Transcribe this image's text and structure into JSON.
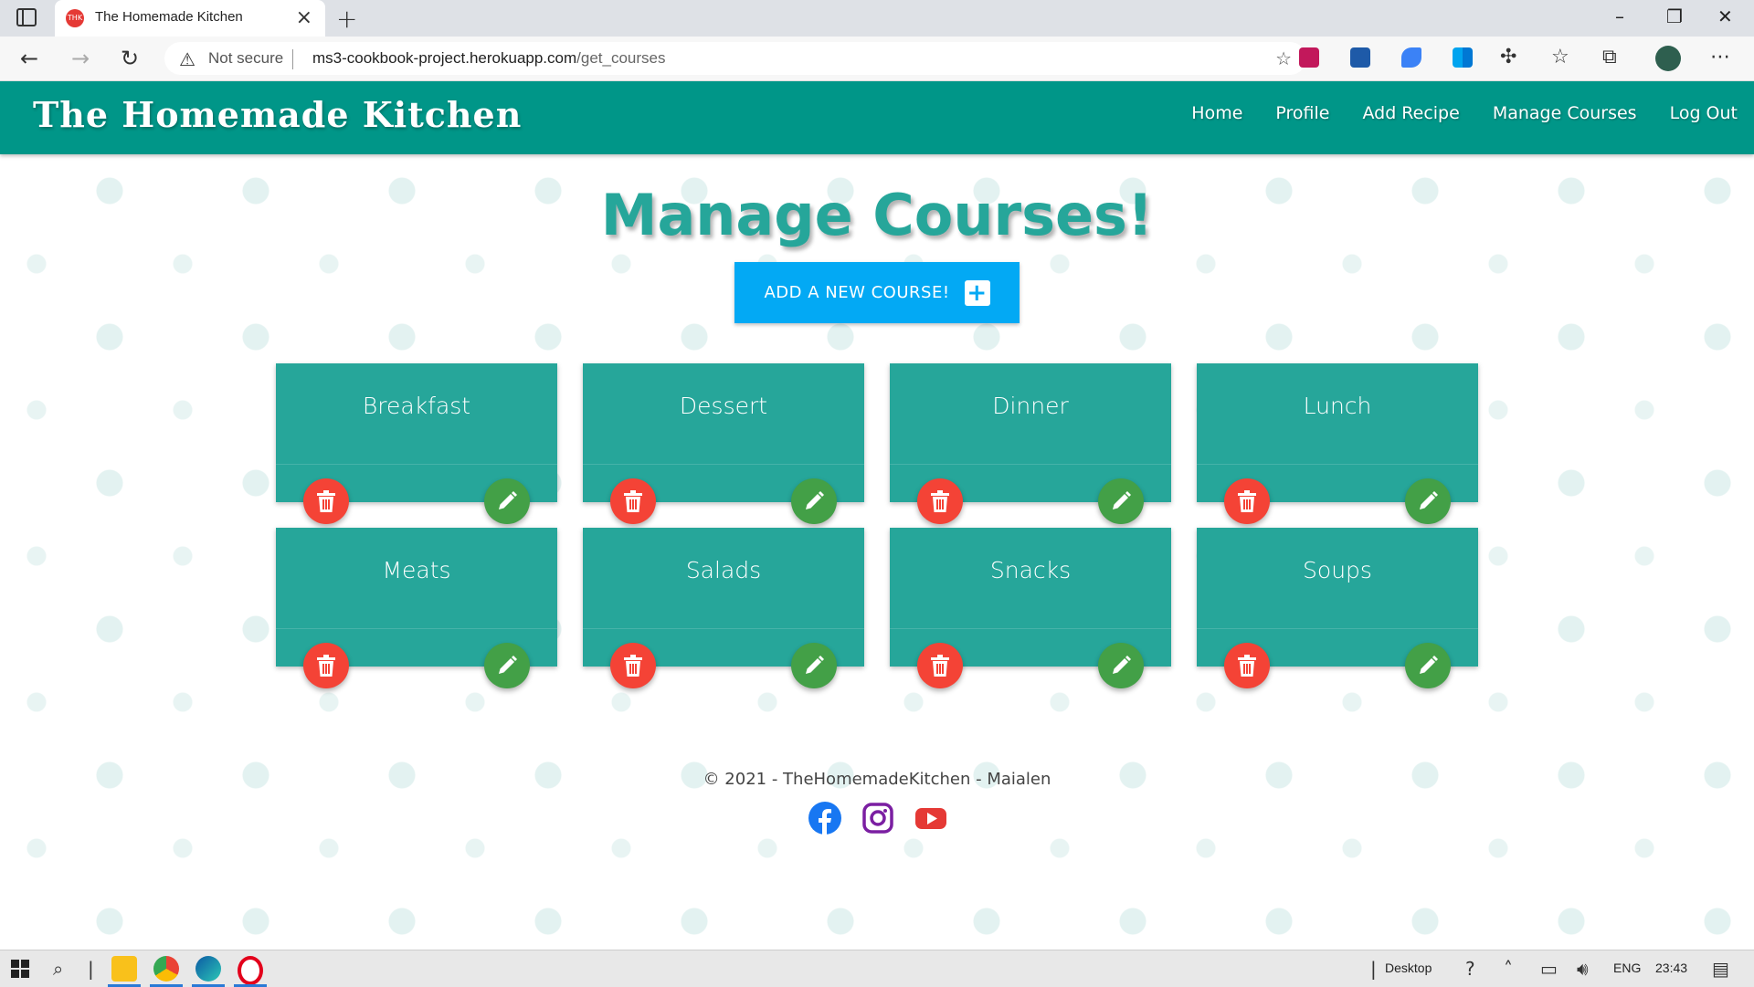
{
  "browser": {
    "tab_title": "The Homemade Kitchen",
    "tab_favicon_text": "THK",
    "security_label": "Not secure",
    "url_host": "ms3-cookbook-project.herokuapp.com",
    "url_path": "/get_courses"
  },
  "site": {
    "brand": "The Homemade Kitchen",
    "nav": [
      {
        "label": "Home"
      },
      {
        "label": "Profile"
      },
      {
        "label": "Add Recipe"
      },
      {
        "label": "Manage Courses"
      },
      {
        "label": "Log Out"
      }
    ]
  },
  "main": {
    "title": "Manage Courses!",
    "add_button_label": "ADD A NEW COURSE!",
    "courses": [
      {
        "name": "Breakfast"
      },
      {
        "name": "Dessert"
      },
      {
        "name": "Dinner"
      },
      {
        "name": "Lunch"
      },
      {
        "name": "Meats"
      },
      {
        "name": "Salads"
      },
      {
        "name": "Snacks"
      },
      {
        "name": "Soups"
      }
    ]
  },
  "footer": {
    "text": "© 2021 - TheHomemadeKitchen - Maialen",
    "socials": [
      "facebook-icon",
      "instagram-icon",
      "youtube-icon"
    ]
  },
  "taskbar": {
    "desktop_label": "Desktop",
    "language": "ENG",
    "time": "23:43"
  },
  "colors": {
    "primary": "#009688",
    "card": "#26a69a",
    "add_button": "#03a9f4",
    "delete": "#f44336",
    "edit": "#43a047"
  }
}
